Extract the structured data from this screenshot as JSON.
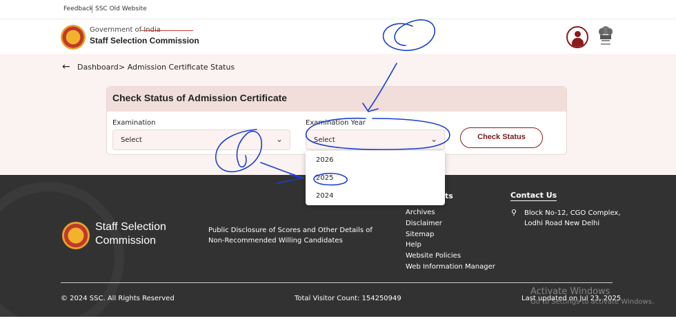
{
  "topbar": {
    "feedback": "Feedback",
    "old_site": "SSC Old Website"
  },
  "header": {
    "gov": "Government of India",
    "org": "Staff Selection Commission"
  },
  "breadcrumb": {
    "home": "Dashboard",
    "current": "> Admission Certificate Status"
  },
  "card": {
    "title": "Check Status of Admission Certificate",
    "exam_label": "Examination",
    "exam_value": "Select",
    "year_label": "Examination Year",
    "year_value": "Select",
    "button": "Check Status"
  },
  "dropdown": {
    "options": [
      "2026",
      "2025",
      "2024"
    ]
  },
  "footer": {
    "org_line1": "Staff Selection",
    "org_line2": "Commission",
    "disclosure": "Public Disclosure of Scores and Other Details of Non-Recommended Willing Candidates",
    "links_heading_fragment": "ts",
    "links": [
      "Archives",
      "Disclaimer",
      "Sitemap",
      "Help",
      "Website Policies",
      "Web Information Manager"
    ],
    "contact_heading": "Contact Us",
    "address": "Block No-12, CGO Complex, Lodhi Road New Delhi",
    "copyright": "© 2024 SSC. All Rights Reserved",
    "visitor": "Total Visitor Count: 154250949",
    "updated": "Last updated on Jul 23, 2025"
  },
  "watermark": {
    "line1": "Activate Windows",
    "line2": "Go to Settings to activate Windows."
  },
  "colors": {
    "accent": "#8b1a1a",
    "card_header": "#f1dedb",
    "footer_bg": "#333232",
    "annotation": "#1a3fd1"
  },
  "icons": {
    "back": "arrow-left-icon",
    "chevron": "chevron-down-icon",
    "pin": "location-pin-icon"
  }
}
